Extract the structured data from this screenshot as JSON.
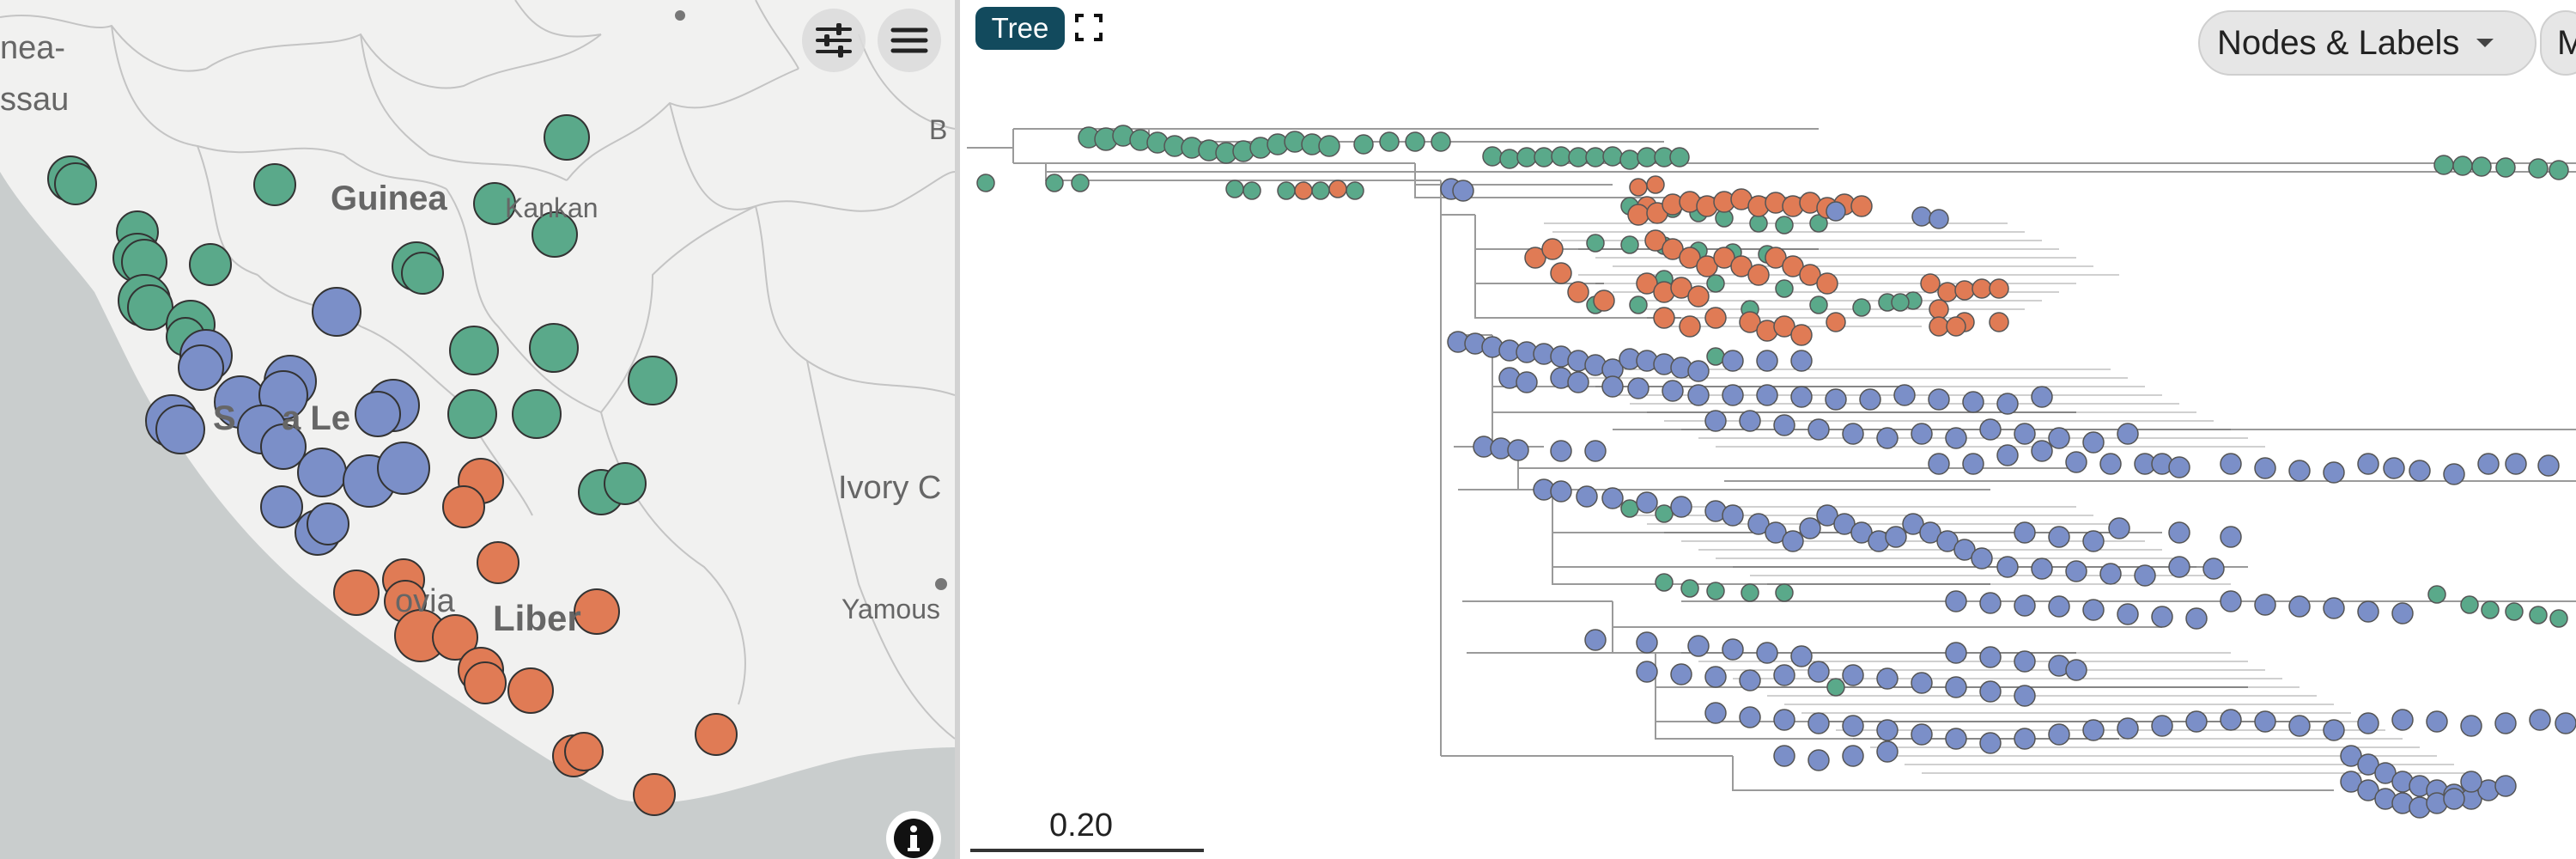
{
  "colors": {
    "lineage_green": "#5aa98a",
    "lineage_orange": "#e07b55",
    "lineage_blue": "#7b8fc8",
    "accent": "#124a5d",
    "sea": "#c9cdcd",
    "land": "#f1f1f0"
  },
  "map": {
    "labels": {
      "guinea_bissau_1": "nea-",
      "guinea_bissau_2": "ssau",
      "guinea": "Guinea",
      "kankan": "Kankan",
      "sierra_leone_1": "S",
      "sierra_leone_2": "a Le",
      "ivory_coast": "Ivory C",
      "yamous": "Yamous",
      "monrovia": "ovia",
      "liberia": "Liber",
      "b_edge": "B"
    },
    "controls": {
      "filter_icon": "sliders-icon",
      "menu_icon": "hamburger-menu-icon",
      "info_icon": "info-icon"
    }
  },
  "tree": {
    "tab_label": "Tree",
    "expand_icon": "expand-icon",
    "dropdown_label": "Nodes & Labels",
    "next_button_label": "M",
    "scale_label": "0.20"
  }
}
